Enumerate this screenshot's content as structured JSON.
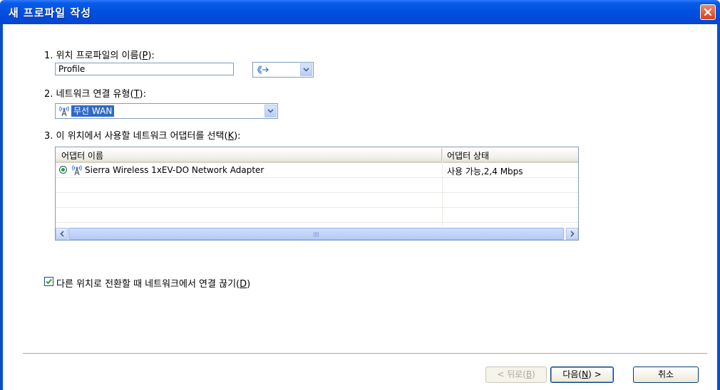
{
  "window": {
    "title": "새 프로파일 작성"
  },
  "step1": {
    "label_prefix": "1. 위치 프로파일의 이름(",
    "label_key": "P",
    "label_suffix": "):",
    "name_value": "Profile"
  },
  "step2": {
    "label_prefix": "2. 네트워크 연결 유형(",
    "label_key": "T",
    "label_suffix": "):",
    "selected_type": "무선 WAN"
  },
  "step3": {
    "label_prefix": "3. 이 위치에서 사용할 네트워크 어댑터를 선택(",
    "label_key": "K",
    "label_suffix": "):",
    "columns": [
      "어댑터 이름",
      "어댑터 상태"
    ],
    "rows": [
      {
        "name": "Sierra Wireless 1xEV-DO Network Adapter",
        "status": "사용 가능,2,4 Mbps"
      }
    ]
  },
  "option": {
    "label_prefix": "다른 위치로 전환할 때 네트워크에서 연결 끊기(",
    "label_key": "D",
    "label_suffix": ")",
    "checked": true
  },
  "buttons": {
    "back_prefix": "< 뒤로(",
    "back_key": "B",
    "back_suffix": ")",
    "next_prefix": "다음(",
    "next_key": "N",
    "next_suffix": ") >",
    "cancel": "취소"
  },
  "icons": {
    "close": "close-icon",
    "profile_icon": "network-location-icon",
    "wireless_wan": "wireless-antenna-icon"
  },
  "colors": {
    "titlebar": "#0054e3",
    "selection": "#316ac5",
    "close": "#d4421f"
  }
}
